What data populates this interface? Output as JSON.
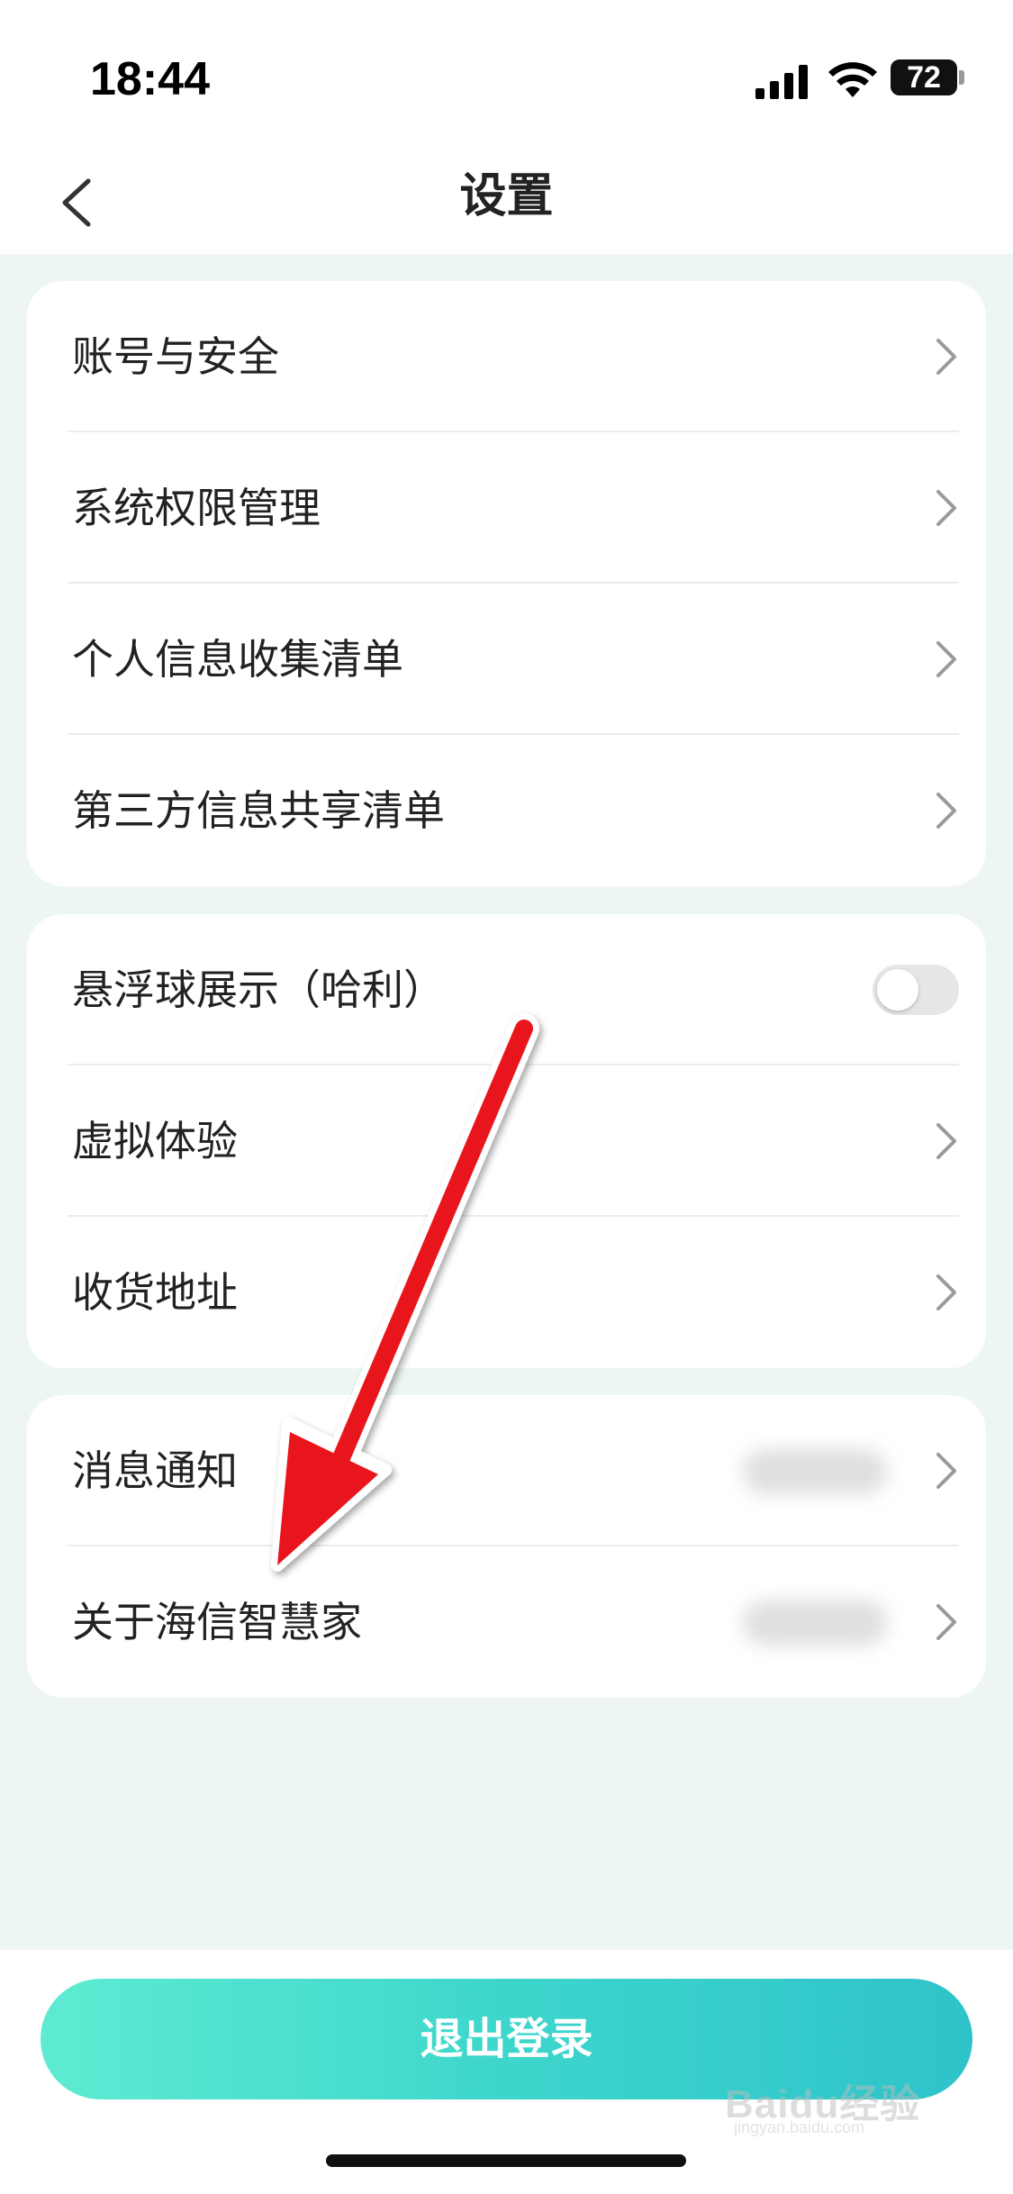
{
  "status_bar": {
    "time": "18:44",
    "battery": "72"
  },
  "header": {
    "title": "设置"
  },
  "groups": [
    {
      "items": [
        {
          "label": "账号与安全"
        },
        {
          "label": "系统权限管理"
        },
        {
          "label": "个人信息收集清单"
        },
        {
          "label": "第三方信息共享清单"
        }
      ]
    },
    {
      "items": [
        {
          "label": "悬浮球展示（哈利）",
          "toggle_on": false
        },
        {
          "label": "虚拟体验"
        },
        {
          "label": "收货地址"
        }
      ]
    },
    {
      "items": [
        {
          "label": "消息通知"
        },
        {
          "label": "关于海信智慧家"
        }
      ]
    }
  ],
  "logout_label": "退出登录",
  "watermark": {
    "text": "Baidu经验",
    "sub": "jingyan.baidu.com"
  },
  "colors": {
    "accent_start": "#5eebd2",
    "accent_end": "#2ec3ca",
    "annotation_arrow": "#e8141b"
  }
}
